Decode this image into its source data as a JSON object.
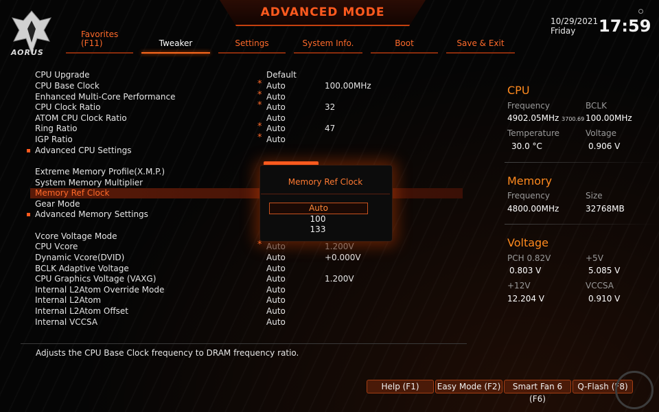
{
  "header": {
    "title": "ADVANCED MODE",
    "brand": "AORUS",
    "date": "10/29/2021",
    "day": "Friday",
    "time": "17:59"
  },
  "tabs": [
    {
      "label": "Favorites\n(F11)"
    },
    {
      "label": "Tweaker"
    },
    {
      "label": "Settings"
    },
    {
      "label": "System Info."
    },
    {
      "label": "Boot"
    },
    {
      "label": "Save & Exit"
    }
  ],
  "settings": [
    {
      "name": "CPU Upgrade",
      "value": "Default",
      "extra": ""
    },
    {
      "name": "CPU Base Clock",
      "star": "*",
      "value": "Auto",
      "extra": "100.00MHz"
    },
    {
      "name": "Enhanced Multi-Core Performance",
      "star": "*",
      "value": "Auto",
      "extra": ""
    },
    {
      "name": "CPU Clock Ratio",
      "star": "*",
      "value": "Auto",
      "extra": "32"
    },
    {
      "name": "ATOM CPU Clock Ratio",
      "value": "Auto",
      "extra": ""
    },
    {
      "name": "Ring Ratio",
      "star": "*",
      "value": "Auto",
      "extra": "47"
    },
    {
      "name": "IGP Ratio",
      "star": "*",
      "value": "Auto",
      "extra": ""
    },
    {
      "name": "Advanced CPU Settings"
    },
    {
      "name": "Extreme Memory Profile(X.M.P.)"
    },
    {
      "name": "System Memory Multiplier"
    },
    {
      "name": "Memory Ref Clock"
    },
    {
      "name": "Gear Mode"
    },
    {
      "name": "Advanced Memory Settings"
    },
    {
      "name": "Vcore Voltage Mode"
    },
    {
      "name": "CPU Vcore",
      "star": "*",
      "value": "Auto",
      "extra": "1.200V"
    },
    {
      "name": "Dynamic Vcore(DVID)",
      "value": "Auto",
      "extra": "+0.000V"
    },
    {
      "name": "BCLK Adaptive Voltage",
      "value": "Auto",
      "extra": ""
    },
    {
      "name": "CPU Graphics Voltage (VAXG)",
      "value": "Auto",
      "extra": "1.200V"
    },
    {
      "name": "Internal L2Atom Override Mode",
      "value": "Auto",
      "extra": ""
    },
    {
      "name": "Internal L2Atom",
      "value": "Auto",
      "extra": ""
    },
    {
      "name": "Internal L2Atom Offset",
      "value": "Auto",
      "extra": ""
    },
    {
      "name": "Internal VCCSA",
      "value": "Auto",
      "extra": ""
    }
  ],
  "info": {
    "cpu": {
      "title": "CPU",
      "freq_label": "Frequency",
      "freq": "4902.05MHz",
      "freq_sub": "3700.69",
      "bclk_label": "BCLK",
      "bclk": "100.00MHz",
      "temp_label": "Temperature",
      "temp": "30.0 °C",
      "volt_label": "Voltage",
      "volt": "0.906 V"
    },
    "memory": {
      "title": "Memory",
      "freq_label": "Frequency",
      "freq": "4800.00MHz",
      "size_label": "Size",
      "size": "32768MB"
    },
    "voltage": {
      "title": "Voltage",
      "pch_label": "PCH 0.82V",
      "pch": "0.803 V",
      "v5_label": "+5V",
      "v5": "5.085 V",
      "v12_label": "+12V",
      "v12": "12.204 V",
      "vccsa_label": "VCCSA",
      "vccsa": "0.910 V"
    }
  },
  "popup": {
    "title": "Memory Ref Clock",
    "options": [
      "Auto",
      "100",
      "133"
    ]
  },
  "help_text": "Adjusts the CPU Base Clock frequency to DRAM frequency ratio.",
  "buttons": [
    "Help (F1)",
    "Easy Mode (F2)",
    "Smart Fan 6 (F6)",
    "Q-Flash (F8)"
  ],
  "colors": {
    "accent": "#ff6a1e",
    "selected_row": "#5a1a08",
    "panel_label": "#9a9a9a"
  }
}
